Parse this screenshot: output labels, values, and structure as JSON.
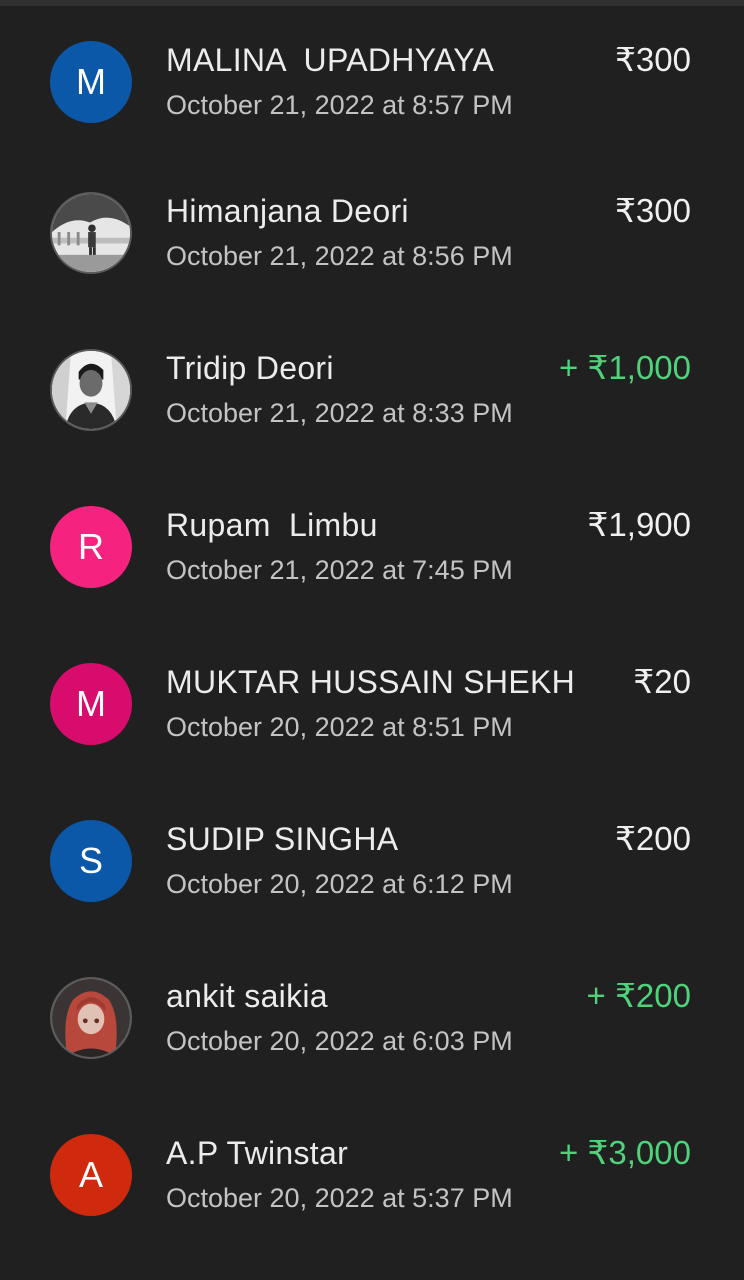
{
  "transactions": [
    {
      "name": "MALINA  UPADHYAYA",
      "date": "October 21, 2022 at 8:57 PM",
      "amount": "₹300",
      "type": "debit",
      "avatar": {
        "kind": "initial",
        "letter": "M",
        "color": "#0b57a8"
      }
    },
    {
      "name": "Himanjana Deori",
      "date": "October 21, 2022 at 8:56 PM",
      "amount": "₹300",
      "type": "debit",
      "avatar": {
        "kind": "photo",
        "icon": "person-photo-outdoor"
      }
    },
    {
      "name": "Tridip Deori",
      "date": "October 21, 2022 at 8:33 PM",
      "amount": "+ ₹1,000",
      "type": "credit",
      "avatar": {
        "kind": "photo",
        "icon": "person-photo-portrait"
      }
    },
    {
      "name": "Rupam  Limbu",
      "date": "October 21, 2022 at 7:45 PM",
      "amount": "₹1,900",
      "type": "debit",
      "avatar": {
        "kind": "initial",
        "letter": "R",
        "color": "#f5237f"
      }
    },
    {
      "name": "MUKTAR HUSSAIN SHEKH",
      "date": "October 20, 2022 at 8:51 PM",
      "amount": "₹20",
      "type": "debit",
      "avatar": {
        "kind": "initial",
        "letter": "M",
        "color": "#d80c6d"
      }
    },
    {
      "name": "SUDIP SINGHA",
      "date": "October 20, 2022 at 6:12 PM",
      "amount": "₹200",
      "type": "debit",
      "avatar": {
        "kind": "initial",
        "letter": "S",
        "color": "#0b57a8"
      }
    },
    {
      "name": "ankit saikia",
      "date": "October 20, 2022 at 6:03 PM",
      "amount": "+ ₹200",
      "type": "credit",
      "avatar": {
        "kind": "photo",
        "icon": "anime-character-photo"
      }
    },
    {
      "name": "A.P Twinstar",
      "date": "October 20, 2022 at 5:37 PM",
      "amount": "+ ₹3,000",
      "type": "credit",
      "avatar": {
        "kind": "initial",
        "letter": "A",
        "color": "#cf2a0e"
      }
    }
  ],
  "colors": {
    "background": "#202020",
    "credit": "#4fd37a",
    "text": "#ececec",
    "subtext": "#c3c3c3"
  }
}
